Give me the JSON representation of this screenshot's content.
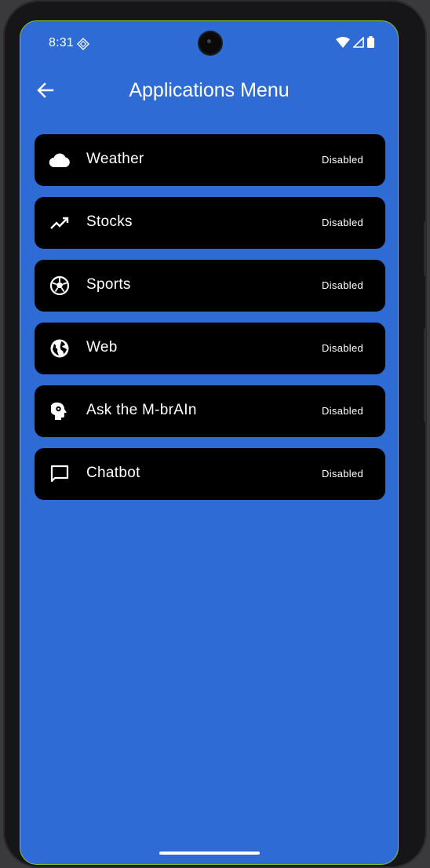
{
  "status_bar": {
    "time": "8:31"
  },
  "app_bar": {
    "title": "Applications Menu"
  },
  "menu": {
    "items": [
      {
        "label": "Weather",
        "status": "Disabled",
        "icon": "cloud-icon"
      },
      {
        "label": "Stocks",
        "status": "Disabled",
        "icon": "trending-up-icon"
      },
      {
        "label": "Sports",
        "status": "Disabled",
        "icon": "soccer-ball-icon"
      },
      {
        "label": "Web",
        "status": "Disabled",
        "icon": "globe-icon"
      },
      {
        "label": "Ask the M-brAIn",
        "status": "Disabled",
        "icon": "psychology-head-icon"
      },
      {
        "label": "Chatbot",
        "status": "Disabled",
        "icon": "chat-bubble-icon"
      }
    ]
  },
  "colors": {
    "background": "#2f6bd4",
    "card": "#000000",
    "text": "#ffffff"
  }
}
